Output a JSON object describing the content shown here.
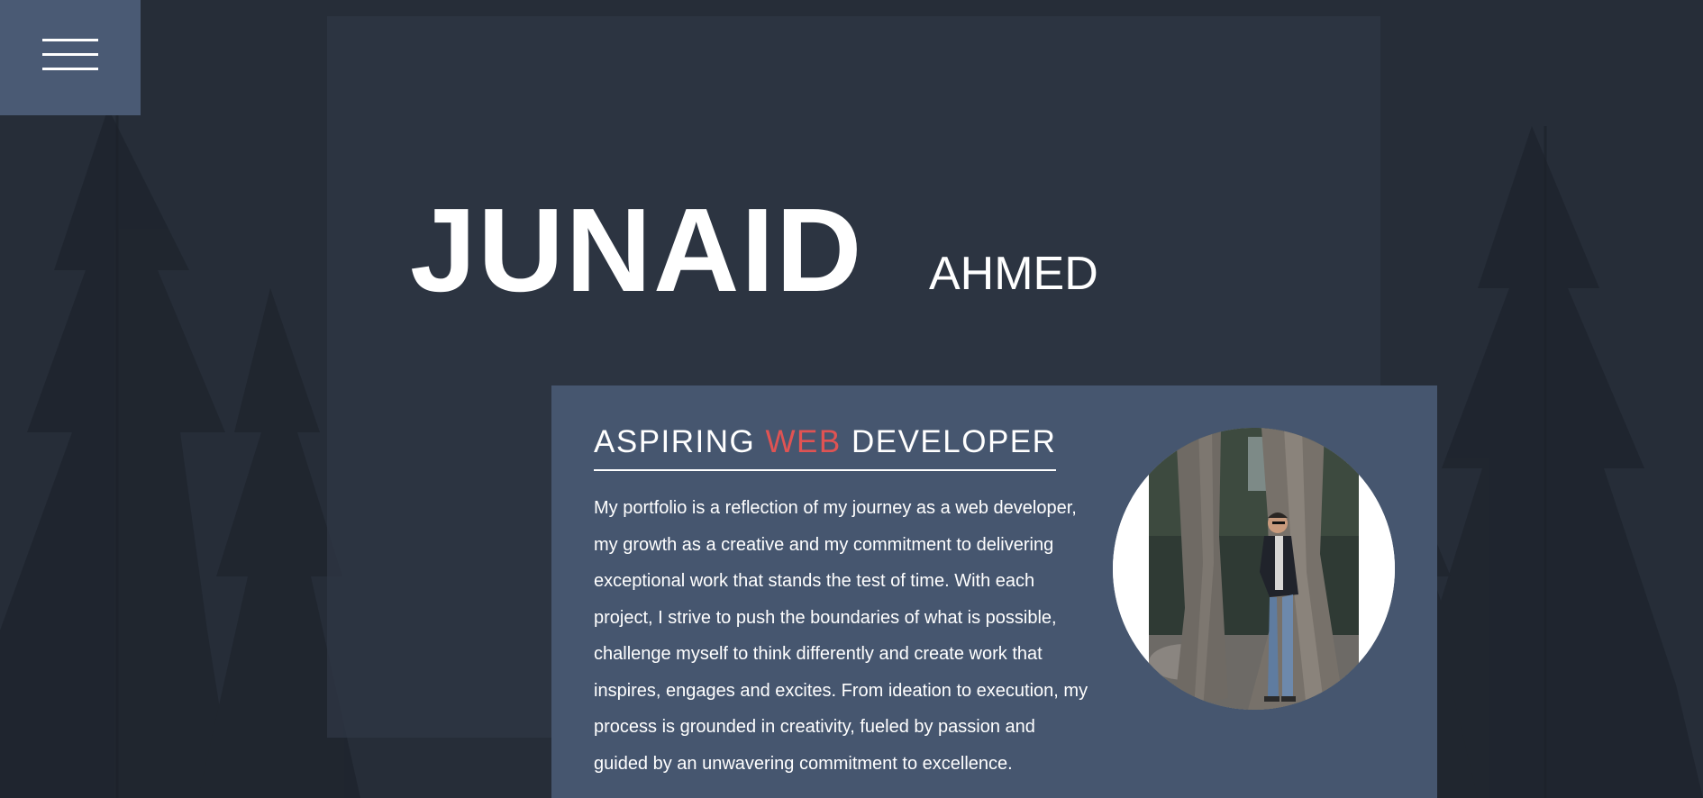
{
  "menu": {
    "icon": "hamburger-menu-icon"
  },
  "hero": {
    "first_name": "JUNAID",
    "last_name": "AHMED"
  },
  "about": {
    "role_prefix": "ASPIRING ",
    "role_accent": "WEB",
    "role_suffix": " DEVELOPER",
    "bio": "My portfolio is a reflection of my journey as a web developer, my growth as a creative and my commitment to delivering exceptional work that stands the test of time. With each project, I strive to push the boundaries of what is possible, challenge myself to think differently and create work that inspires, engages and excites. From ideation to execution, my process is grounded in creativity, fueled by passion and guided by an unwavering commitment to excellence.",
    "photo": "profile-photo"
  },
  "colors": {
    "background": "#262d38",
    "hero_panel": "#2e3644",
    "card": "#46566f",
    "menu_button": "#4a5a74",
    "accent": "#e05353",
    "text": "#ffffff"
  }
}
